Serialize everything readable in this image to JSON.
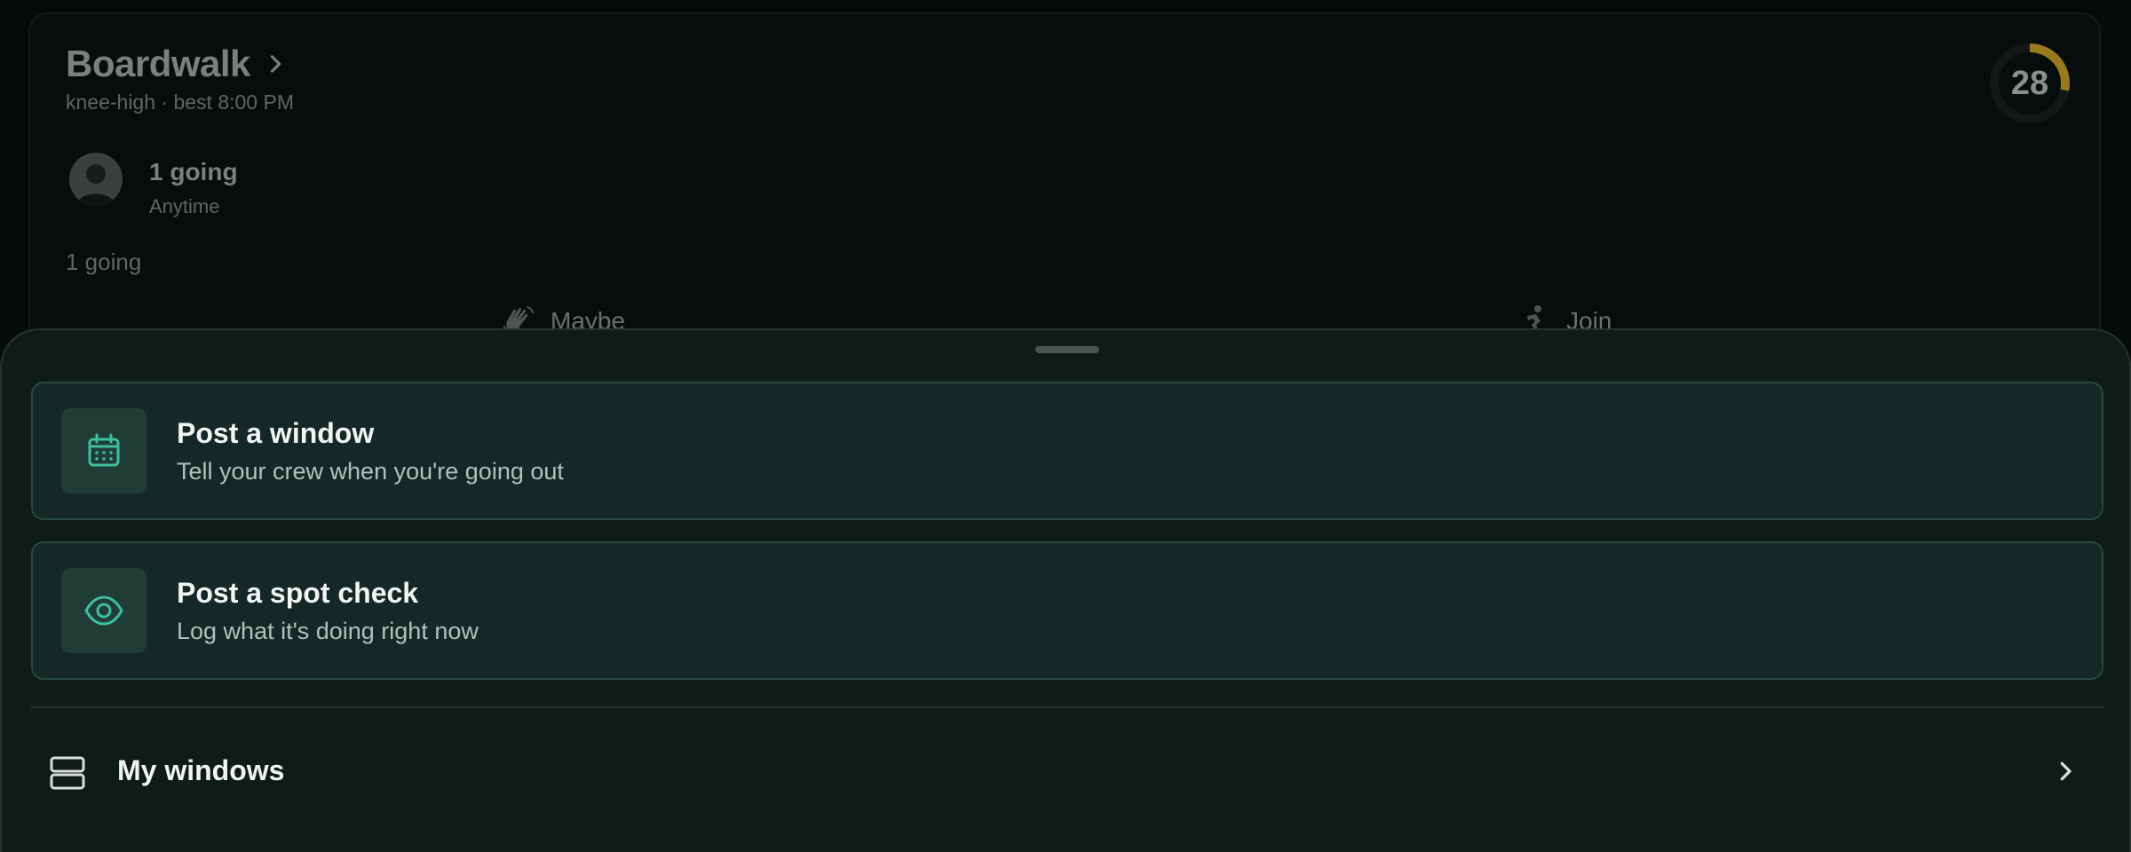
{
  "colors": {
    "accent": "#3fbf9a",
    "score_ring": "#9a7a1f",
    "sheet_bg": "#0f1b19",
    "card_bg": "#152825",
    "card_border": "#27483d"
  },
  "spot": {
    "name": "Boardwalk",
    "subtitle": "knee-high · best 8:00 PM",
    "score": "28",
    "score_fraction": 0.28,
    "going_title": "1 going",
    "going_when": "Anytime",
    "going_summary": "1 going",
    "actions": [
      {
        "label": "Maybe",
        "icon": "waving-hand-icon"
      },
      {
        "label": "Join",
        "icon": "surfer-icon"
      }
    ]
  },
  "sheet": {
    "options": [
      {
        "title": "Post a window",
        "subtitle": "Tell your crew when you're going out",
        "icon": "calendar-icon"
      },
      {
        "title": "Post a spot check",
        "subtitle": "Log what it's doing right now",
        "icon": "eye-icon"
      }
    ],
    "list": [
      {
        "label": "My windows",
        "icon": "stack-icon"
      }
    ]
  }
}
